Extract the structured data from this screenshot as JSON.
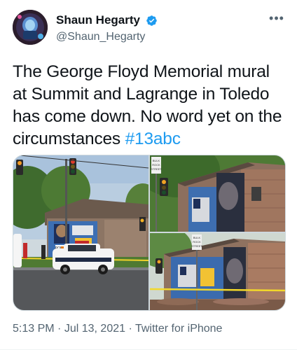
{
  "author": {
    "display_name": "Shaun Hegarty",
    "handle": "@Shaun_Hegarty",
    "verified": true,
    "avatar_icon": "profile-photo"
  },
  "tweet": {
    "text": "The George Floyd Memorial mural at Summit and Lagrange in Toledo has come down. No word yet on the circumstances",
    "hashtag": "#13abc"
  },
  "media": {
    "count": 3,
    "photos": [
      {
        "sign_lines": [
          "POLICE"
        ]
      },
      {
        "sign_lines": [
          "BULK",
          "ROCK",
          "STREET"
        ]
      },
      {
        "sign_lines": [
          "BULK",
          "ROCK",
          "STREET"
        ]
      }
    ]
  },
  "meta": {
    "time": "5:13 PM",
    "separator": "·",
    "date": "Jul 13, 2021",
    "source": "Twitter for iPhone"
  },
  "colors": {
    "accent": "#1d9bf0",
    "text_secondary": "#536471"
  }
}
